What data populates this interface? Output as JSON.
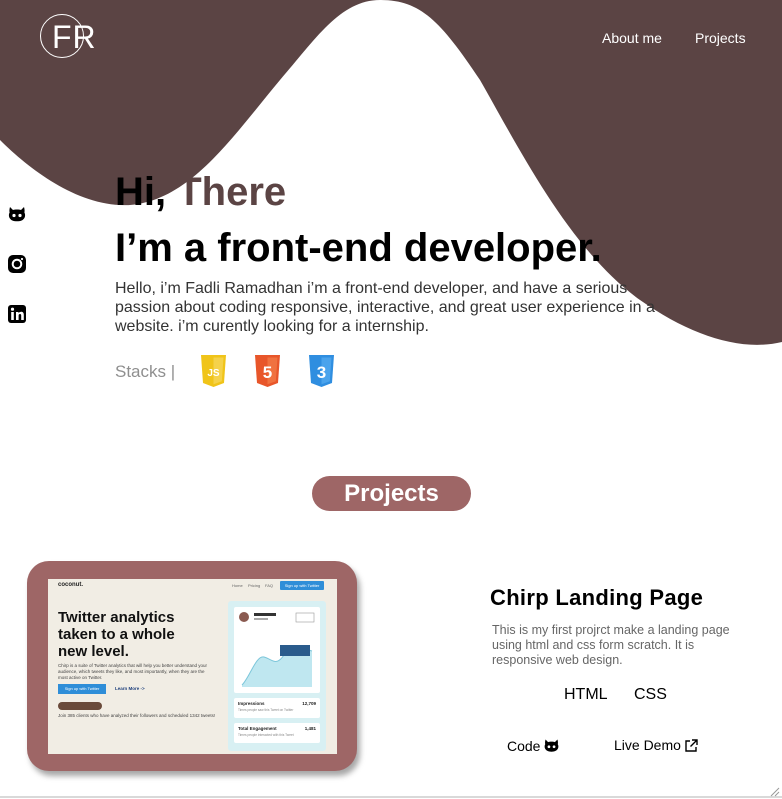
{
  "header": {
    "logo_text": "FR",
    "nav": [
      {
        "label": "About me"
      },
      {
        "label": "Projects"
      }
    ]
  },
  "social": [
    {
      "icon": "github-icon"
    },
    {
      "icon": "instagram-icon"
    },
    {
      "icon": "linkedin-icon"
    }
  ],
  "hero": {
    "greeting": "Hi,",
    "greeting_accent": "There",
    "title": "I’m a front-end developer.",
    "description": "Hello, i’m Fadli Ramadhan i’m a front-end developer, and have a serious passion about coding responsive, interactive, and great user experience in a website. i’m curently looking for a internship.",
    "stacks_label": "Stacks |",
    "stacks": [
      {
        "icon": "javascript-icon",
        "color": "#f0c419",
        "label": "JS"
      },
      {
        "icon": "html5-icon",
        "color": "#e8562a",
        "label": "5"
      },
      {
        "icon": "css3-icon",
        "color": "#2f8ee0",
        "label": "3"
      }
    ]
  },
  "projects_section": {
    "heading": "Projects"
  },
  "project": {
    "title": "Chirp Landing Page",
    "description": "This is my first projrct make a landing page using html and css form scratch. It is responsive web design.",
    "tech": [
      "HTML",
      "CSS"
    ],
    "code_label": "Code",
    "demo_label": "Live Demo",
    "preview": {
      "logo": "coconut.",
      "nav": [
        "Home",
        "Pricing",
        "FAQ"
      ],
      "signup": "Sign up with Twitter",
      "headline": "Twitter analytics taken to a whole new level.",
      "copy": "Chirp is a suite of Twitter analytics that will help you better understand your audience, which tweets they like, and most importantly, when they are the most active on Twitter.",
      "cta": "Sign up with Twitter",
      "learn_more": "Learn More ->",
      "join_text": "Join 385 clients who have analyzed their followers and scheduled 1342 tweets!",
      "impressions_label": "Impressions",
      "impressions_value": "12,709",
      "impressions_sub": "Times people saw this Tweet on Twitter",
      "engagement_label": "Total Engagement",
      "engagement_value": "1,481",
      "engagement_sub": "Times people interacted with this Tweet"
    }
  },
  "colors": {
    "brand_dark": "#5b4444",
    "pill": "#9e6666",
    "card": "#9e6666"
  }
}
